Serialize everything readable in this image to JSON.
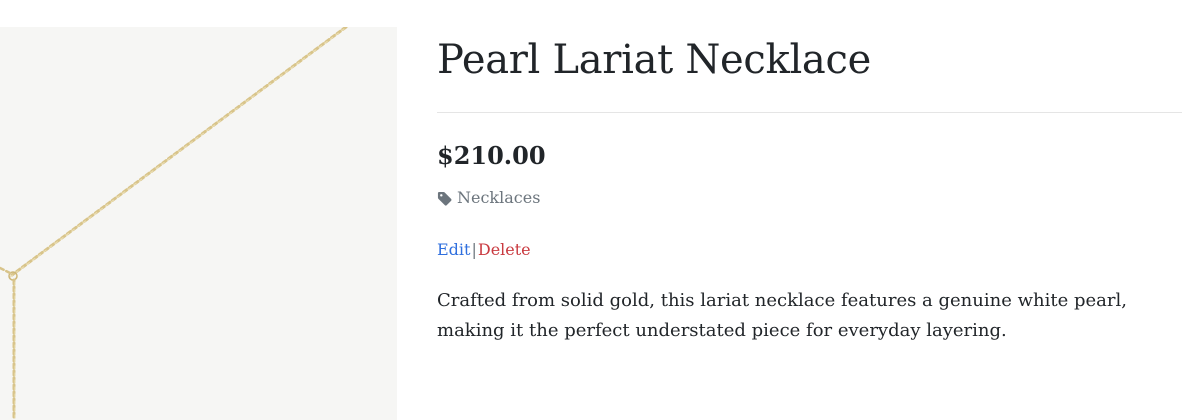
{
  "product": {
    "title": "Pearl Lariat Necklace",
    "price": "$210.00",
    "category": {
      "icon": "tag-icon",
      "label": "Necklaces"
    },
    "actions": {
      "edit_label": "Edit",
      "separator": "|",
      "delete_label": "Delete"
    },
    "description": "Crafted from solid gold, this lariat necklace features a genuine white pearl, making it the perfect understated piece for everyday layering."
  },
  "colors": {
    "edit_link": "#2f6fde",
    "delete_link": "#c93a40",
    "muted_text": "#6c757d",
    "chain_gold": "#d8c48a",
    "image_background": "#f6f6f4"
  }
}
